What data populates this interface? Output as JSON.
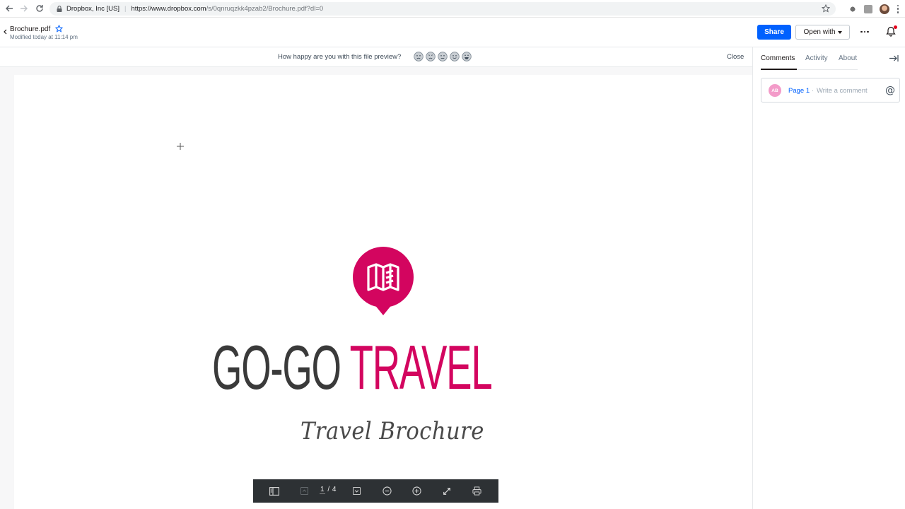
{
  "browser": {
    "org": "Dropbox, Inc [US]",
    "url_host": "https://www.dropbox.com",
    "url_path": "/s/0qnruqzkk4pzab2/Brochure.pdf?dl=0"
  },
  "header": {
    "file_name": "Brochure.pdf",
    "modified": "Modified today at 11:14 pm",
    "share_label": "Share",
    "open_with_label": "Open with"
  },
  "feedback": {
    "question": "How happy are you with this file preview?",
    "close_label": "Close",
    "faces": [
      "very-unhappy-face-icon",
      "unhappy-face-icon",
      "neutral-face-icon",
      "happy-face-icon",
      "very-happy-face-icon"
    ]
  },
  "document": {
    "title_dark": "GO-GO",
    "title_pink": "TRAVEL",
    "subtitle": "Travel Brochure",
    "brand_color": "#d3055f"
  },
  "toolbar": {
    "current_page": "1",
    "page_sep": "/",
    "total_pages": "4"
  },
  "sidebar": {
    "tabs": [
      "Comments",
      "Activity",
      "About"
    ],
    "avatar_initials": "AB",
    "page_ref": "Page 1",
    "separator": "·",
    "comment_placeholder": "Write a comment",
    "at_symbol": "@"
  },
  "colors": {
    "accent": "#0061fe",
    "toolbar_bg": "#2d3134"
  }
}
